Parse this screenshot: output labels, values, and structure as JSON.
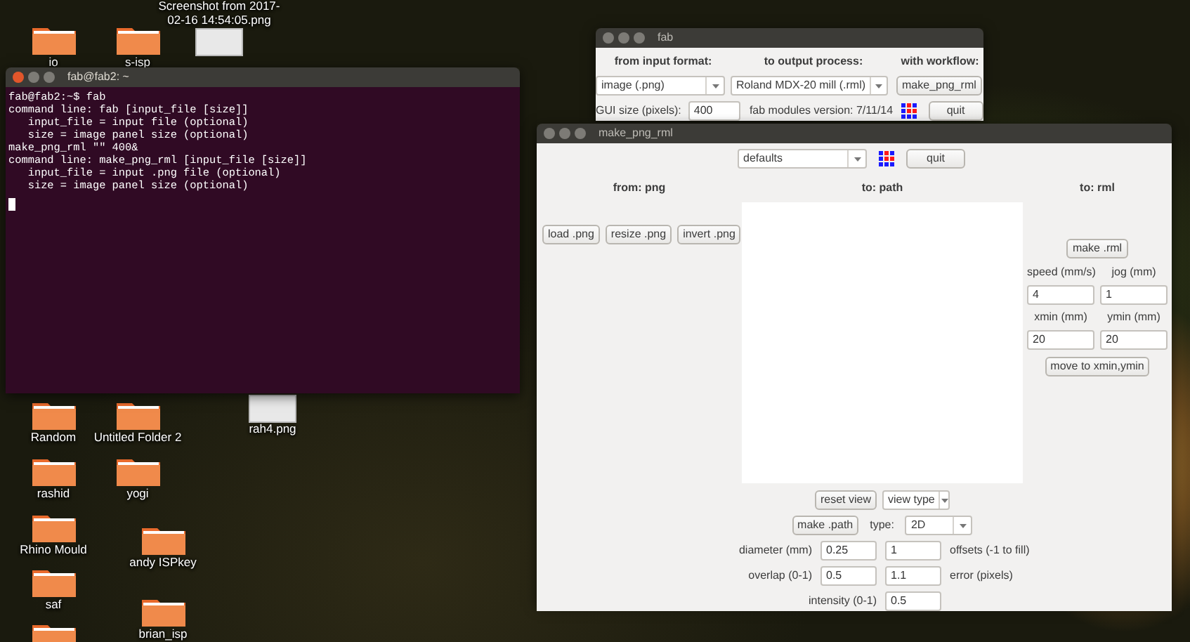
{
  "desktop_icons": [
    {
      "kind": "folder",
      "label": "io"
    },
    {
      "kind": "folder",
      "label": "s-isp"
    },
    {
      "kind": "image",
      "label": "Screenshot from 2017-02-16 14:54:05.png"
    },
    {
      "kind": "folder",
      "label": "Random"
    },
    {
      "kind": "folder",
      "label": "Untitled Folder 2"
    },
    {
      "kind": "image",
      "label": "rah4.png"
    },
    {
      "kind": "folder",
      "label": "rashid"
    },
    {
      "kind": "folder",
      "label": "yogi"
    },
    {
      "kind": "folder",
      "label": "Rhino Mould"
    },
    {
      "kind": "folder",
      "label": "andy ISPkey"
    },
    {
      "kind": "folder",
      "label": "saf"
    },
    {
      "kind": "folder",
      "label": "brian_isp"
    },
    {
      "kind": "folder"
    }
  ],
  "terminal": {
    "title": "fab@fab2: ~",
    "focused": true,
    "lines": [
      "fab@fab2:~$ fab",
      "command line: fab [input_file [size]]",
      "   input_file = input file (optional)",
      "   size = image panel size (optional)",
      "make_png_rml \"\" 400&",
      "command line: make_png_rml [input_file [size]]",
      "   input_file = input .png file (optional)",
      "   size = image panel size (optional)"
    ]
  },
  "fab_window": {
    "title": "fab",
    "focused": false,
    "headings": [
      "from input format:",
      "to output process:",
      "with workflow:"
    ],
    "input_format": {
      "value": "image (.png)"
    },
    "output_process": {
      "value": "Roland MDX-20 mill (.rml)"
    },
    "workflow_button": "make_png_rml",
    "gui_size_label": "GUI size (pixels):",
    "gui_size_value": "400",
    "version": "fab modules version: 7/11/14",
    "quit_button": "quit"
  },
  "make_window": {
    "title": "make_png_rml",
    "focused": false,
    "defaults_select": {
      "value": "defaults"
    },
    "quit_button": "quit",
    "from": {
      "heading": "from: png",
      "buttons": [
        "load .png",
        "resize .png",
        "invert .png"
      ]
    },
    "path": {
      "heading": "to: path",
      "reset_button": "reset view",
      "view_type_select": {
        "value": "view type"
      },
      "make_button": "make .path",
      "type_label": "type:",
      "type_select": {
        "value": "2D"
      },
      "parameters": [
        {
          "kind": "pair",
          "label": "diameter (mm)",
          "value": "0.25",
          "value_2": "1",
          "note": "offsets (-1 to fill)"
        },
        {
          "kind": "pair",
          "label": "overlap (0-1)",
          "value": "0.5",
          "value_2": "1.1",
          "note": "error (pixels)"
        },
        {
          "kind": "single",
          "label": "intensity (0-1)",
          "value": "0.5"
        }
      ]
    },
    "rml": {
      "heading": "to: rml",
      "make_button": "make .rml",
      "fields": [
        {
          "label": "speed (mm/s)",
          "value": "4"
        },
        {
          "label": "jog (mm)",
          "value": "1"
        },
        {
          "label": "xmin (mm)",
          "value": "20"
        },
        {
          "label": "ymin (mm)",
          "value": "20"
        }
      ],
      "move_button": "move to xmin,ymin"
    }
  }
}
